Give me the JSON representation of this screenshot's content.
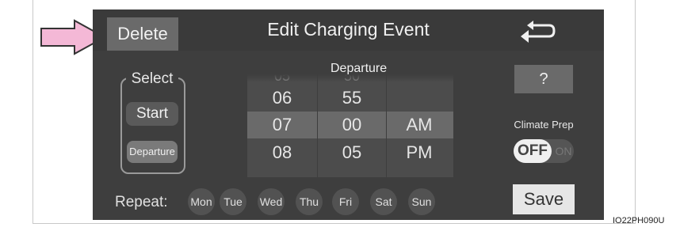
{
  "header": {
    "delete_label": "Delete",
    "title": "Edit Charging Event",
    "back_icon": "back-arrow-icon"
  },
  "select": {
    "label": "Select",
    "start_label": "Start",
    "departure_label": "Departure"
  },
  "picker": {
    "label": "Departure",
    "hours": [
      "06",
      "07",
      "08"
    ],
    "minutes": [
      "55",
      "00",
      "05"
    ],
    "ampm": [
      "",
      "AM",
      "PM"
    ],
    "selected": {
      "hour": "07",
      "minute": "00",
      "ampm": "AM"
    }
  },
  "help_label": "?",
  "climate": {
    "label": "Climate Prep",
    "off_label": "OFF",
    "on_label": "ON",
    "state": "OFF"
  },
  "repeat": {
    "label": "Repeat:",
    "days": [
      "Mon",
      "Tue",
      "Wed",
      "Thu",
      "Fri",
      "Sat",
      "Sun"
    ]
  },
  "save_label": "Save",
  "caption": "IO22PH090U",
  "colors": {
    "screen_bg": "#3e3e3e",
    "pointer_arrow": "#f4b8d6"
  }
}
